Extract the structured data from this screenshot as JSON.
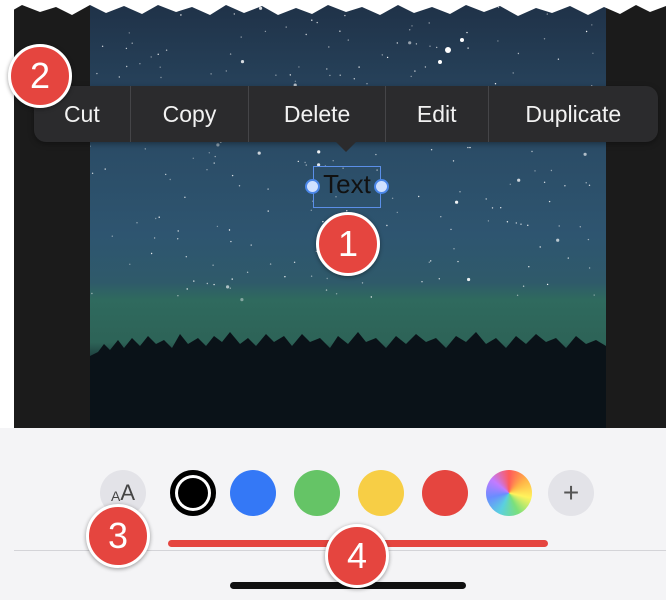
{
  "callout_menu": {
    "items": [
      {
        "label": "Cut"
      },
      {
        "label": "Copy"
      },
      {
        "label": "Delete"
      },
      {
        "label": "Edit"
      },
      {
        "label": "Duplicate"
      }
    ]
  },
  "text_annotation": {
    "label": "Text"
  },
  "badges": {
    "b1": "1",
    "b2": "2",
    "b3": "3",
    "b4": "4"
  },
  "toolbar": {
    "font_button": {
      "small": "A",
      "large": "A"
    },
    "colors": [
      {
        "name": "black",
        "hex": "#000000",
        "selected": true
      },
      {
        "name": "blue",
        "hex": "#3478f6"
      },
      {
        "name": "green",
        "hex": "#65c466"
      },
      {
        "name": "yellow",
        "hex": "#f7ce45"
      },
      {
        "name": "red",
        "hex": "#e5453f"
      },
      {
        "name": "multicolor",
        "hex": "conic"
      }
    ],
    "plus_label": "+"
  },
  "colors": {
    "badge": "#e5453f",
    "selection": "#4a86e8",
    "menu_bg": "#2b2b2d"
  },
  "icons": [
    "font-size-icon",
    "plus-icon"
  ]
}
